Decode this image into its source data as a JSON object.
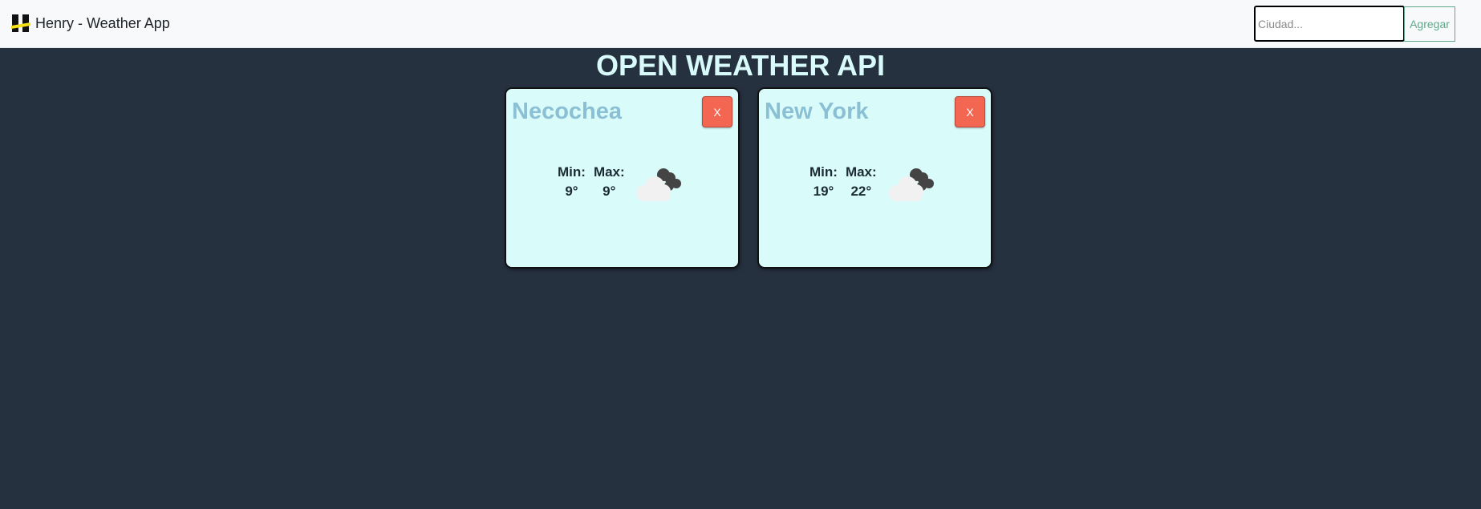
{
  "navbar": {
    "brand_title": "Henry - Weather App",
    "search_placeholder": "Ciudad...",
    "search_value": "",
    "add_label": "Agregar"
  },
  "main": {
    "title": "OPEN WEATHER API"
  },
  "cards": [
    {
      "city": "Necochea",
      "close_label": "X",
      "min_label": "Min:",
      "min_value": "9°",
      "max_label": "Max:",
      "max_value": "9°",
      "icon": "broken-clouds-icon"
    },
    {
      "city": "New York",
      "close_label": "X",
      "min_label": "Min:",
      "min_value": "19°",
      "max_label": "Max:",
      "max_value": "22°",
      "icon": "broken-clouds-icon"
    }
  ],
  "colors": {
    "page_background": "#263140",
    "navbar_background": "#f8f9fa",
    "title": "#d8fafa",
    "card_background": "#d9fcfb",
    "city_text": "#8bbfd4",
    "close_button": "#f26652",
    "add_button_accent": "#5fa98a",
    "logo_yellow": "#f5e11b"
  }
}
